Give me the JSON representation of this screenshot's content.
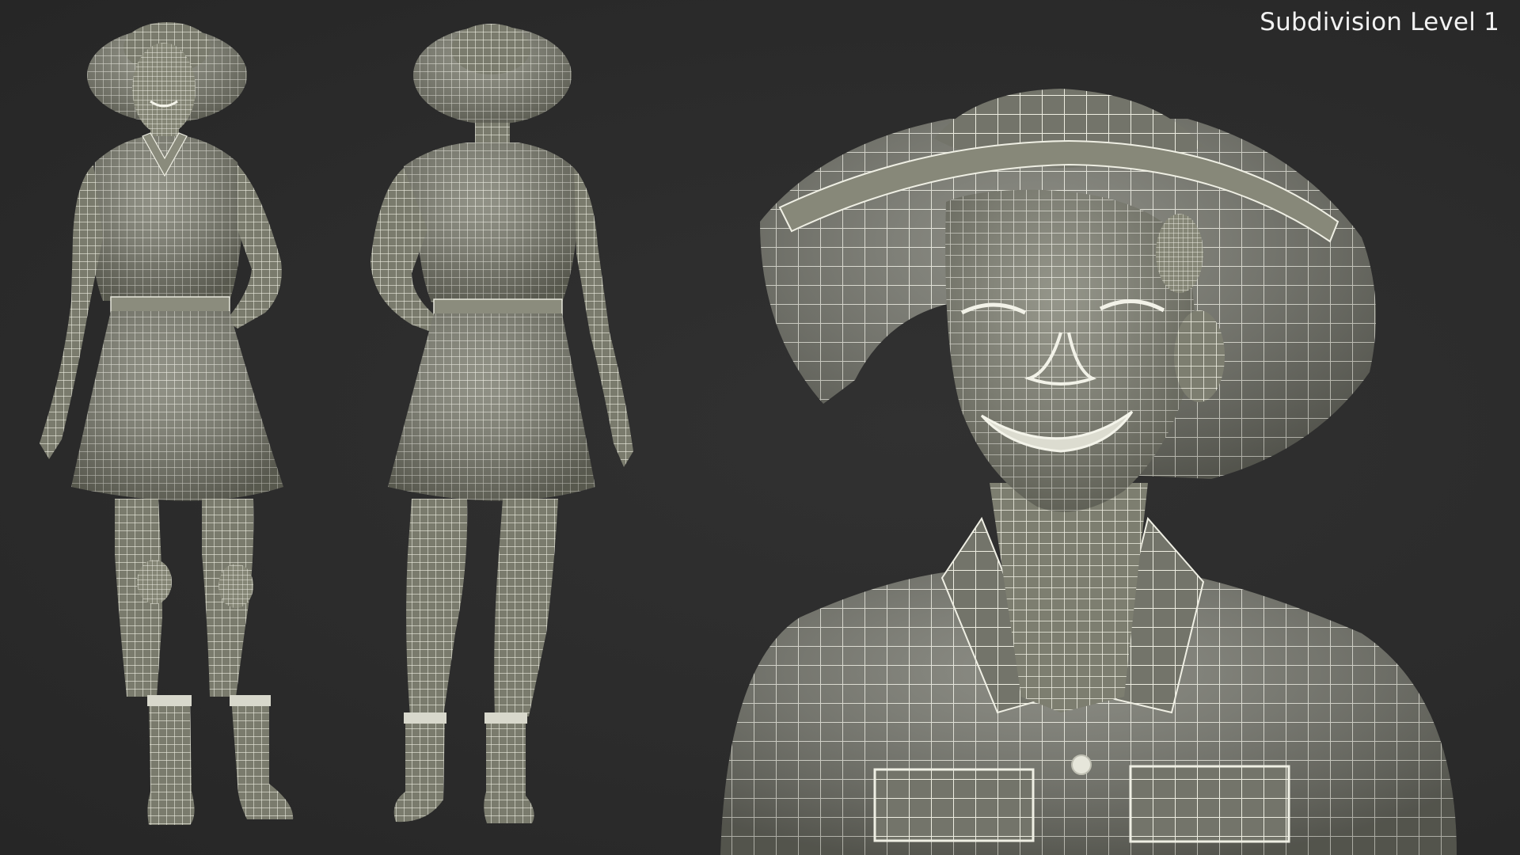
{
  "caption": {
    "text": "Subdivision Level 1"
  },
  "render": {
    "background_color": "#2b2b2b",
    "mesh_fill_color": "#7f8072",
    "wire_color": "#eeeee2",
    "views": [
      "front-full-body",
      "back-full-body",
      "head-closeup"
    ]
  }
}
